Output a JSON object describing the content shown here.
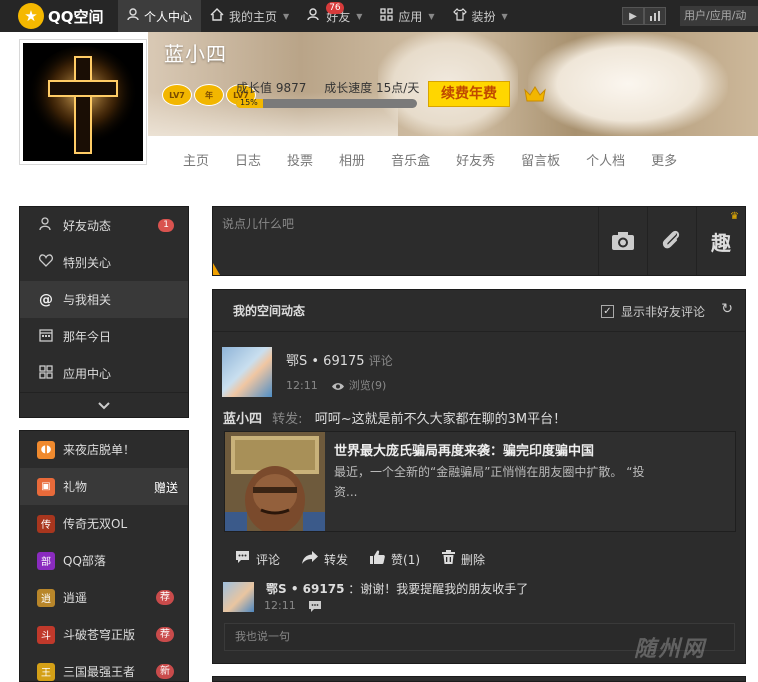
{
  "topbar": {
    "logo": "QQ空间",
    "nav": [
      {
        "label": "个人中心",
        "icon": "person-icon"
      },
      {
        "label": "我的主页",
        "icon": "home-icon"
      },
      {
        "label": "好友",
        "icon": "friends-icon",
        "badge": "76"
      },
      {
        "label": "应用",
        "icon": "apps-grid-icon"
      },
      {
        "label": "装扮",
        "icon": "shirt-icon"
      }
    ],
    "search_placeholder": "用户/应用/动"
  },
  "profile": {
    "name": "蓝小四",
    "growth_value": "成长值 9877",
    "growth_speed": "成长速度 15点/天",
    "progress_label": "15%",
    "progress": 0.15,
    "level_badges": [
      "LV7",
      "年",
      "LV7"
    ],
    "renew_button": "续费年费"
  },
  "tabs": [
    "主页",
    "日志",
    "投票",
    "相册",
    "音乐盒",
    "好友秀",
    "留言板",
    "个人档",
    "更多"
  ],
  "leftnav": {
    "items": [
      {
        "label": "好友动态",
        "icon": "friends-icon",
        "count": "1"
      },
      {
        "label": "特别关心",
        "icon": "heart-icon",
        "count": ""
      },
      {
        "label": "与我相关",
        "icon": "at-icon",
        "count": ""
      },
      {
        "label": "那年今日",
        "icon": "calendar-icon",
        "count": ""
      },
      {
        "label": "应用中心",
        "icon": "apps-grid-icon",
        "count": ""
      }
    ]
  },
  "apps": [
    {
      "label": "来夜店脱单！",
      "color": "#f08a2e",
      "tag": ""
    },
    {
      "label": "礼物",
      "color": "#e86a3a",
      "tag": "",
      "extra": "赠送"
    },
    {
      "label": "传奇无双OL",
      "color": "#a8361e",
      "tag": ""
    },
    {
      "label": "QQ部落",
      "color": "#8a2bbf",
      "tag": ""
    },
    {
      "label": "逍遥",
      "color": "#b8862a",
      "tag": "荐"
    },
    {
      "label": "斗破苍穹正版",
      "color": "#c0392b",
      "tag": "荐"
    },
    {
      "label": "三国最强王者",
      "color": "#d4a017",
      "tag": "新"
    }
  ],
  "postbox": {
    "placeholder": "说点儿什么吧",
    "fun_label": "趣"
  },
  "feed": {
    "title": "我的空间动态",
    "option": "显示非好友评论",
    "post": {
      "user": "鄂S • 69175",
      "user_action": "评论",
      "time": "12:11",
      "views": "浏览(9)",
      "author": "蓝小四",
      "forward": "转发:",
      "text": "呵呵~这就是前不久大家都在聊的3M平台！",
      "share_title": "世界最大庞氏骗局再度来袭：骗完印度骗中国",
      "share_desc": "最近，一个全新的“金融骗局”正悄悄在朋友圈中扩散。        “投资..."
    },
    "actions": [
      "评论",
      "转发",
      "赞(1)",
      "删除"
    ],
    "reply": {
      "user": "鄂S • 69175",
      "text": "：谢谢！我要提醒我的朋友收手了",
      "time": "12:11"
    },
    "comment_placeholder": "我也说一句"
  },
  "watermark": "随州网"
}
